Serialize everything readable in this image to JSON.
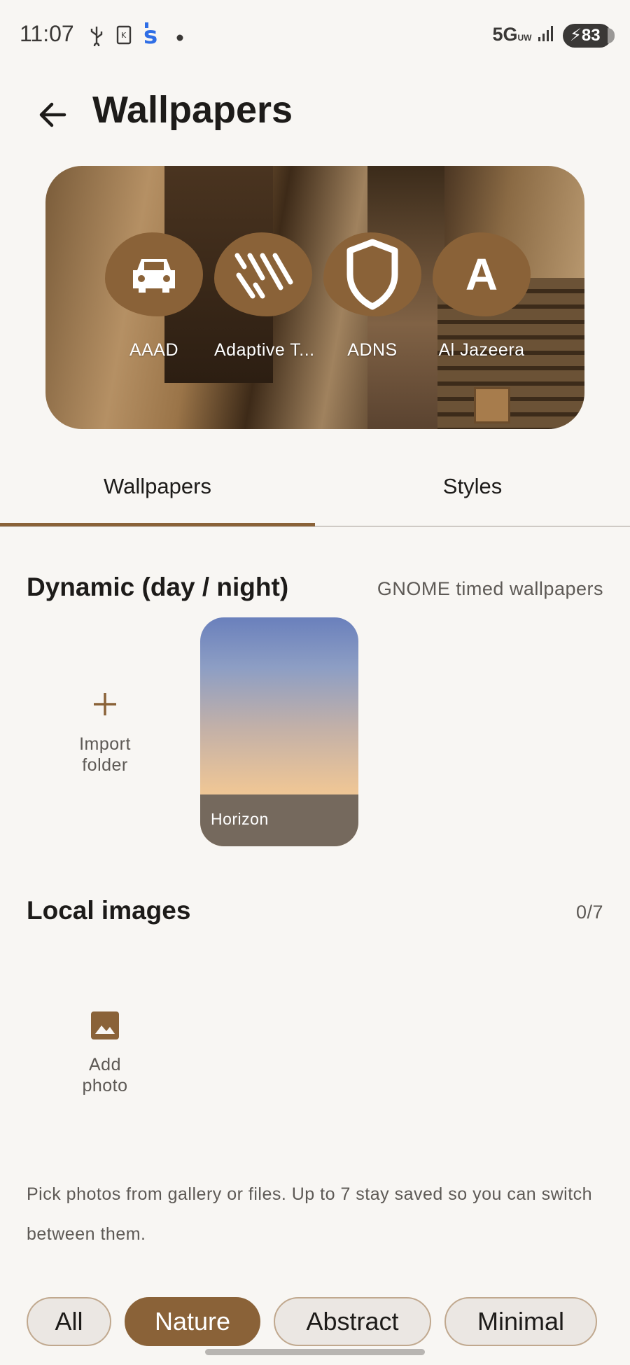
{
  "status": {
    "time": "11:07",
    "network": "5G",
    "network_sub": "UW",
    "battery": "83"
  },
  "header": {
    "title": "Wallpapers"
  },
  "preview": {
    "apps": [
      {
        "label": "AAAD",
        "icon": "car-icon"
      },
      {
        "label": "Adaptive T...",
        "icon": "slashes-icon"
      },
      {
        "label": "ADNS",
        "icon": "shield-icon"
      },
      {
        "label": "Al Jazeera",
        "icon": "letter-a-icon",
        "letter": "A"
      }
    ]
  },
  "tabs": [
    {
      "label": "Wallpapers",
      "selected": true
    },
    {
      "label": "Styles",
      "selected": false
    }
  ],
  "dynamic": {
    "title": "Dynamic (day / night)",
    "subtitle": "GNOME timed wallpapers",
    "import_label_1": "Import",
    "import_label_2": "folder",
    "items": [
      {
        "name": "Horizon"
      }
    ]
  },
  "local": {
    "title": "Local images",
    "count": "0/7",
    "add_label_1": "Add",
    "add_label_2": "photo",
    "hint": "Pick photos from gallery or files. Up to 7 stay saved so you can switch between them."
  },
  "filters": [
    {
      "label": "All",
      "selected": false
    },
    {
      "label": "Nature",
      "selected": true
    },
    {
      "label": "Abstract",
      "selected": false
    },
    {
      "label": "Minimal",
      "selected": false
    }
  ],
  "colors": {
    "accent": "#8a6238",
    "background": "#f8f6f3"
  }
}
